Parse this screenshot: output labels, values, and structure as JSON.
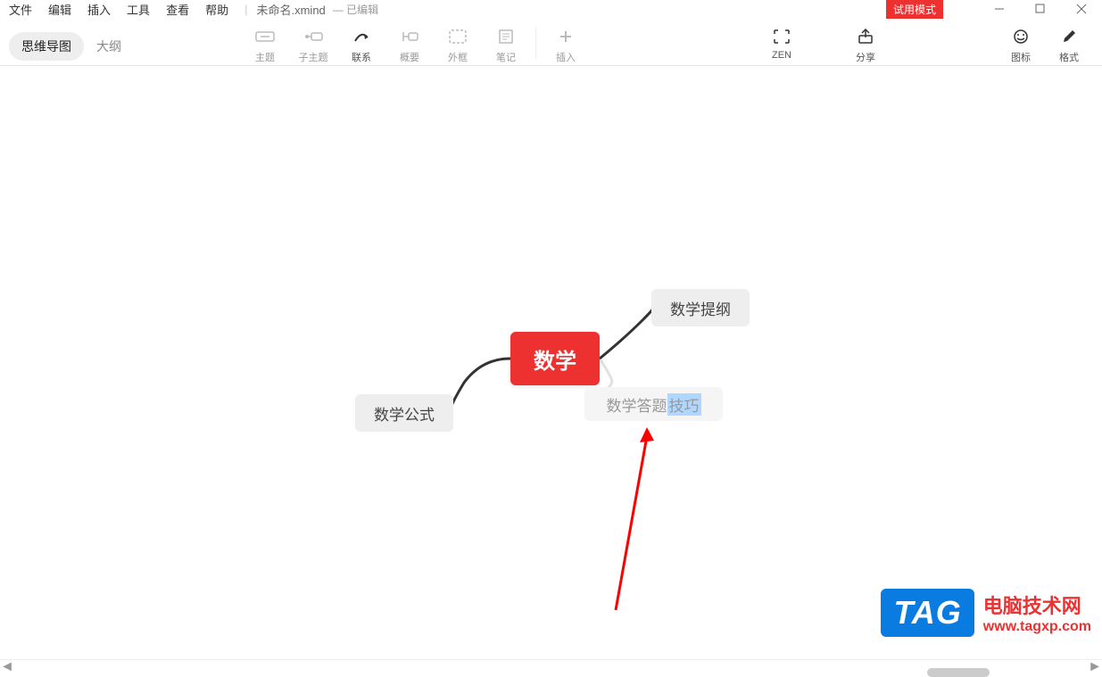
{
  "menu": {
    "items": [
      "文件",
      "编辑",
      "插入",
      "工具",
      "查看",
      "帮助"
    ],
    "filename": "未命名.xmind",
    "status": "— 已编辑"
  },
  "trial_badge": "试用模式",
  "view_tabs": {
    "mindmap": "思维导图",
    "outline": "大纲"
  },
  "tools": {
    "topic": "主题",
    "subtopic": "子主题",
    "relationship": "联系",
    "summary": "概要",
    "boundary": "外框",
    "note": "笔记",
    "insert": "插入",
    "zen": "ZEN",
    "share": "分享",
    "sticker": "图标",
    "format": "格式"
  },
  "mindmap": {
    "center": "数学",
    "nodes": {
      "formula": "数学公式",
      "outline": "数学提纲",
      "skills_prefix": "数学答题",
      "skills_editing": "技巧"
    }
  },
  "watermark": {
    "tag": "TAG",
    "title": "电脑技术网",
    "url": "www.tagxp.com"
  }
}
